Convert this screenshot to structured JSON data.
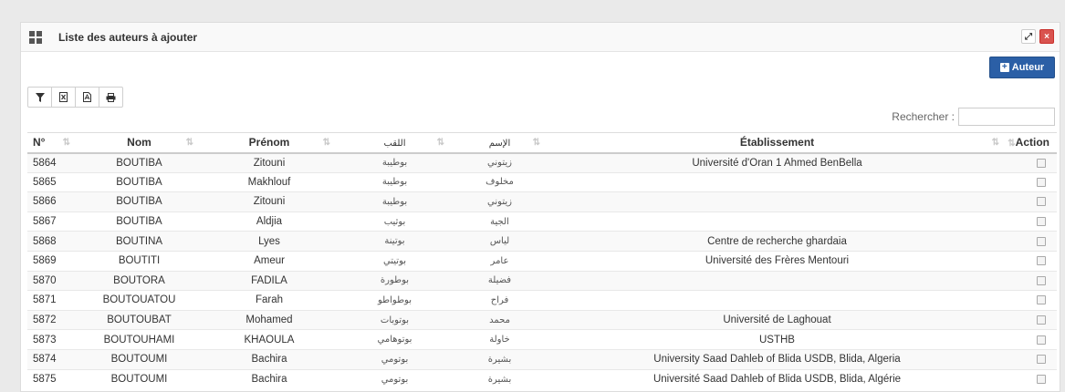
{
  "panel": {
    "title": "Liste des auteurs à ajouter",
    "expand_glyph": "⤢",
    "close_glyph": "×"
  },
  "add_button": {
    "label": "Auteur",
    "color": "#2b5fa6"
  },
  "toolbar": {
    "icons": [
      "filter-icon",
      "excel-icon",
      "pdf-icon",
      "print-icon"
    ]
  },
  "search": {
    "label": "Rechercher :",
    "value": ""
  },
  "table": {
    "headers": {
      "no": "N°",
      "nom": "Nom",
      "prenom": "Prénom",
      "laqab": "اللقب",
      "ism": "الإسم",
      "etab": "Établissement",
      "action": "Action"
    },
    "sort_glyph": "⇅",
    "rows": [
      {
        "no": "5864",
        "nom": "BOUTIBA",
        "prenom": "Zitouni",
        "laqab": "بوطيبة",
        "ism": "زيتوني",
        "etab": "Université d'Oran 1 Ahmed BenBella"
      },
      {
        "no": "5865",
        "nom": "BOUTIBA",
        "prenom": "Makhlouf",
        "laqab": "بوطيبة",
        "ism": "مخلوف",
        "etab": ""
      },
      {
        "no": "5866",
        "nom": "BOUTIBA",
        "prenom": "Zitouni",
        "laqab": "بوطيبة",
        "ism": "زيتوني",
        "etab": ""
      },
      {
        "no": "5867",
        "nom": "BOUTIBA",
        "prenom": "Aldjia",
        "laqab": "بوثيب",
        "ism": "الجية",
        "etab": ""
      },
      {
        "no": "5868",
        "nom": "BOUTINA",
        "prenom": "Lyes",
        "laqab": "بوتينة",
        "ism": "لياس",
        "etab": "Centre de recherche ghardaia"
      },
      {
        "no": "5869",
        "nom": "BOUTITI",
        "prenom": "Ameur",
        "laqab": "بوتيتي",
        "ism": "عامر",
        "etab": "Université des Frères Mentouri"
      },
      {
        "no": "5870",
        "nom": "BOUTORA",
        "prenom": "FADILA",
        "laqab": "بوطورة",
        "ism": "فضيلة",
        "etab": ""
      },
      {
        "no": "5871",
        "nom": "BOUTOUATOU",
        "prenom": "Farah",
        "laqab": "بوطواطو",
        "ism": "فراح",
        "etab": ""
      },
      {
        "no": "5872",
        "nom": "BOUTOUBAT",
        "prenom": "Mohamed",
        "laqab": "بوتوبات",
        "ism": "محمد",
        "etab": "Université de Laghouat"
      },
      {
        "no": "5873",
        "nom": "BOUTOUHAMI",
        "prenom": "KHAOULA",
        "laqab": "بوتوهامي",
        "ism": "خاولة",
        "etab": "USTHB"
      },
      {
        "no": "5874",
        "nom": "BOUTOUMI",
        "prenom": "Bachira",
        "laqab": "بوتومي",
        "ism": "بشيرة",
        "etab": "University Saad Dahleb of Blida USDB, Blida, Algeria"
      },
      {
        "no": "5875",
        "nom": "BOUTOUMI",
        "prenom": "Bachira",
        "laqab": "بوتومي",
        "ism": "بشيرة",
        "etab": "Université Saad Dahleb of Blida USDB, Blida, Algérie"
      }
    ]
  }
}
